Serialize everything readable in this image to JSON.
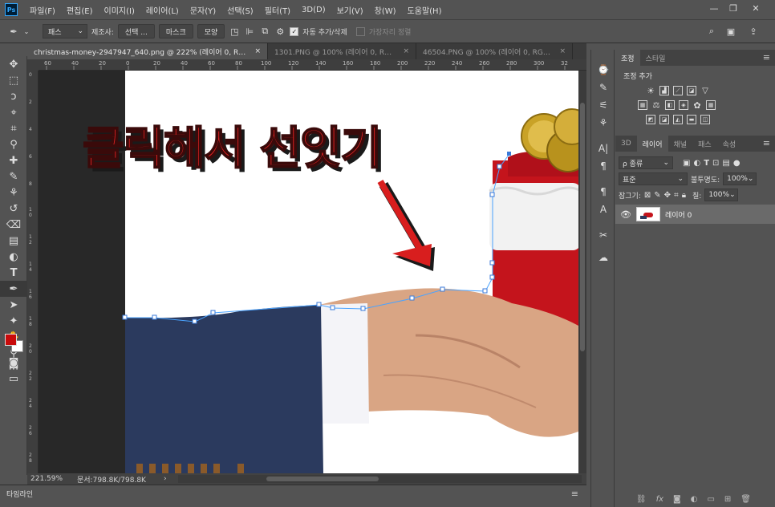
{
  "app": {
    "logo": "Ps"
  },
  "menu": [
    "파일(F)",
    "편집(E)",
    "이미지(I)",
    "레이어(L)",
    "문자(Y)",
    "선택(S)",
    "필터(T)",
    "3D(D)",
    "보기(V)",
    "창(W)",
    "도움말(H)"
  ],
  "window_controls": {
    "minimize": "—",
    "restore": "❐",
    "close": "✕"
  },
  "options": {
    "mode_value": "패스",
    "make_label": "제조사:",
    "select_btn": "선택 ...",
    "mask_btn": "마스크",
    "shape_btn": "모양",
    "auto_add_label": "자동 추가/삭제",
    "align_edges_label": "가장자리 정렬"
  },
  "tabs": [
    {
      "label": "christmas-money-2947947_640.png @ 222% (레이어 0, RGB/8) *",
      "close": "×"
    },
    {
      "label": "1301.PNG @ 100% (레이어 0, RGB/...",
      "close": "×"
    },
    {
      "label": "46504.PNG @ 100% (레이어 0, RGB/...",
      "close": "×"
    }
  ],
  "ruler_top": [
    "60",
    "40",
    "20",
    "0",
    "20",
    "40",
    "60",
    "80",
    "100",
    "120",
    "140",
    "160",
    "180",
    "200",
    "220",
    "240",
    "260",
    "280",
    "300",
    "32"
  ],
  "ruler_left": [
    "0",
    "2",
    "4",
    "6",
    "8",
    "1 0",
    "1 2",
    "1 4",
    "1 6",
    "1 8",
    "2 0",
    "2 2",
    "2 4",
    "2 6",
    "2 8"
  ],
  "canvas": {
    "overlay_text": "클릭해서 선잇기"
  },
  "status": {
    "zoom": "221.59%",
    "doc": "문서:798.8K/798.8K",
    "arrow": "›"
  },
  "timeline": {
    "label": "타임라인"
  },
  "adjustments": {
    "tab1": "조정",
    "tab2": "스타일",
    "heading": "조정 추가"
  },
  "layers": {
    "tabs": [
      "3D",
      "레이어",
      "채널",
      "패스",
      "속성"
    ],
    "active_tab": "레이어",
    "filter_label": "ρ 종류",
    "blend_mode": "표준",
    "opacity_label": "불투명도:",
    "opacity_value": "100%",
    "lock_label": "잠그기:",
    "fill_label": "칠:",
    "fill_value": "100%",
    "items": [
      {
        "name": "레이어 0"
      }
    ]
  },
  "colors": {
    "fg": "#c80b0b",
    "bg": "#ffffff",
    "accent": "#31a8ff"
  }
}
